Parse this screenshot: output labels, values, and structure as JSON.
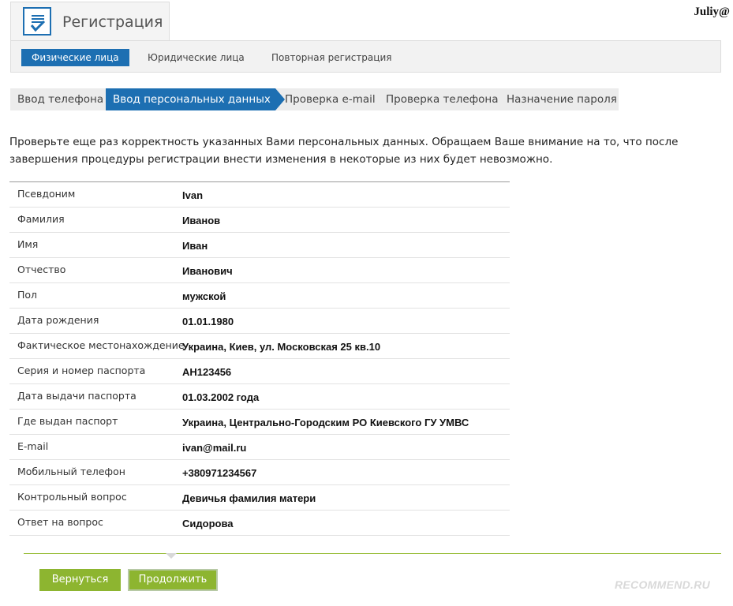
{
  "user": {
    "name": "Juliy@"
  },
  "header": {
    "title": "Регистрация",
    "logo_icon": "document-check-icon"
  },
  "subnav": {
    "items": [
      {
        "label": "Физические лица",
        "active": true
      },
      {
        "label": "Юридические лица",
        "active": false
      },
      {
        "label": "Повторная регистрация",
        "active": false
      }
    ]
  },
  "steps": [
    {
      "label": "Ввод телефона",
      "active": false
    },
    {
      "label": "Ввод персональных данных",
      "active": true
    },
    {
      "label": "Проверка e-mail",
      "active": false
    },
    {
      "label": "Проверка телефона",
      "active": false
    },
    {
      "label": "Назначение пароля",
      "active": false
    }
  ],
  "intro": "Проверьте еще раз корректность указанных Вами персональных данных. Обращаем Ваше внимание на то, что после завершения процедуры регистрации внести изменения в некоторые из них будет невозможно.",
  "fields": [
    {
      "label": "Псевдоним",
      "value": "Ivan"
    },
    {
      "label": "Фамилия",
      "value": "Иванов"
    },
    {
      "label": "Имя",
      "value": "Иван"
    },
    {
      "label": "Отчество",
      "value": "Иванович"
    },
    {
      "label": "Пол",
      "value": " мужской"
    },
    {
      "label": "Дата рождения",
      "value": "01.01.1980"
    },
    {
      "label": "Фактическое местонахождение",
      "value": "Украина, Киев, ул. Московская 25 кв.10"
    },
    {
      "label": "Серия и номер паспорта",
      "value": "АН123456"
    },
    {
      "label": "Дата выдачи паспорта",
      "value": "01.03.2002 года"
    },
    {
      "label": "Где выдан паспорт",
      "value": "Украина, Центрально-Городским РО Киевского ГУ УМВС"
    },
    {
      "label": "E-mail",
      "value": "ivan@mail.ru"
    },
    {
      "label": "Мобильный телефон",
      "value": "+380971234567"
    },
    {
      "label": "Контрольный вопрос",
      "value": " Девичья фамилия матери"
    },
    {
      "label": "Ответ на вопрос",
      "value": "Сидорова"
    }
  ],
  "buttons": {
    "back": "Вернуться",
    "next": "Продолжить"
  },
  "watermark": "RECOMMEND.RU",
  "colors": {
    "accent": "#1d6fb2",
    "button": "#8db530",
    "divider": "#9bbf3d"
  }
}
